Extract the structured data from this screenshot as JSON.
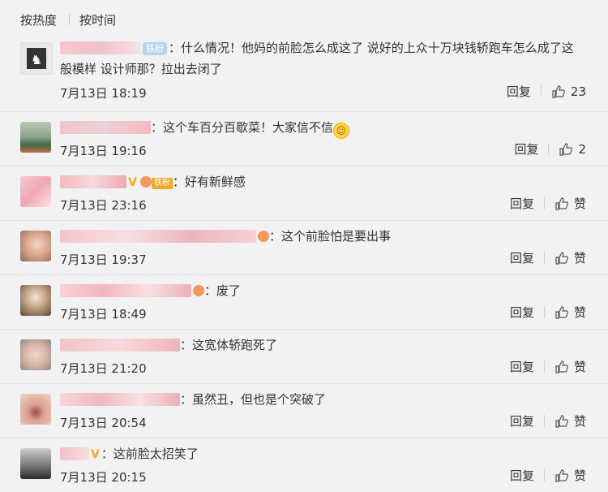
{
  "sort": {
    "hot": "按热度",
    "time": "按时间"
  },
  "icons": {
    "reply": "reply-text",
    "like": "thumbs-up-icon"
  },
  "comments": [
    {
      "badge": "铁粉",
      "text": "：什么情况！他妈的前脸怎么成这了 说好的上众十万块钱轿跑车怎么成了这般模样 设计师那？拉出去闭了",
      "time": "7月13日 18:19",
      "reply": "回复",
      "likes": "23"
    },
    {
      "text": "：这个车百分百歇菜！大家信不信",
      "emoji": "grin",
      "time": "7月13日 19:16",
      "reply": "回复",
      "likes": "2"
    },
    {
      "v": "V",
      "fan_badge": "铁粉",
      "text": "好有新鲜感",
      "time": "7月13日 23:16",
      "reply": "回复",
      "likes": "赞"
    },
    {
      "text": "：这个前脸怕是要出事",
      "time": "7月13日 19:37",
      "reply": "回复",
      "likes": "赞"
    },
    {
      "text": "：废了",
      "time": "7月13日 18:49",
      "reply": "回复",
      "likes": "赞"
    },
    {
      "text": "：这宽体轿跑死了",
      "time": "7月13日 21:20",
      "reply": "回复",
      "likes": "赞"
    },
    {
      "text": "：虽然丑，但也是个突破了",
      "time": "7月13日 20:54",
      "reply": "回复",
      "likes": "赞"
    },
    {
      "v": "V",
      "text": "：这前脸太招笑了",
      "time": "7月13日 20:15",
      "reply": "回复",
      "likes": "赞"
    }
  ]
}
